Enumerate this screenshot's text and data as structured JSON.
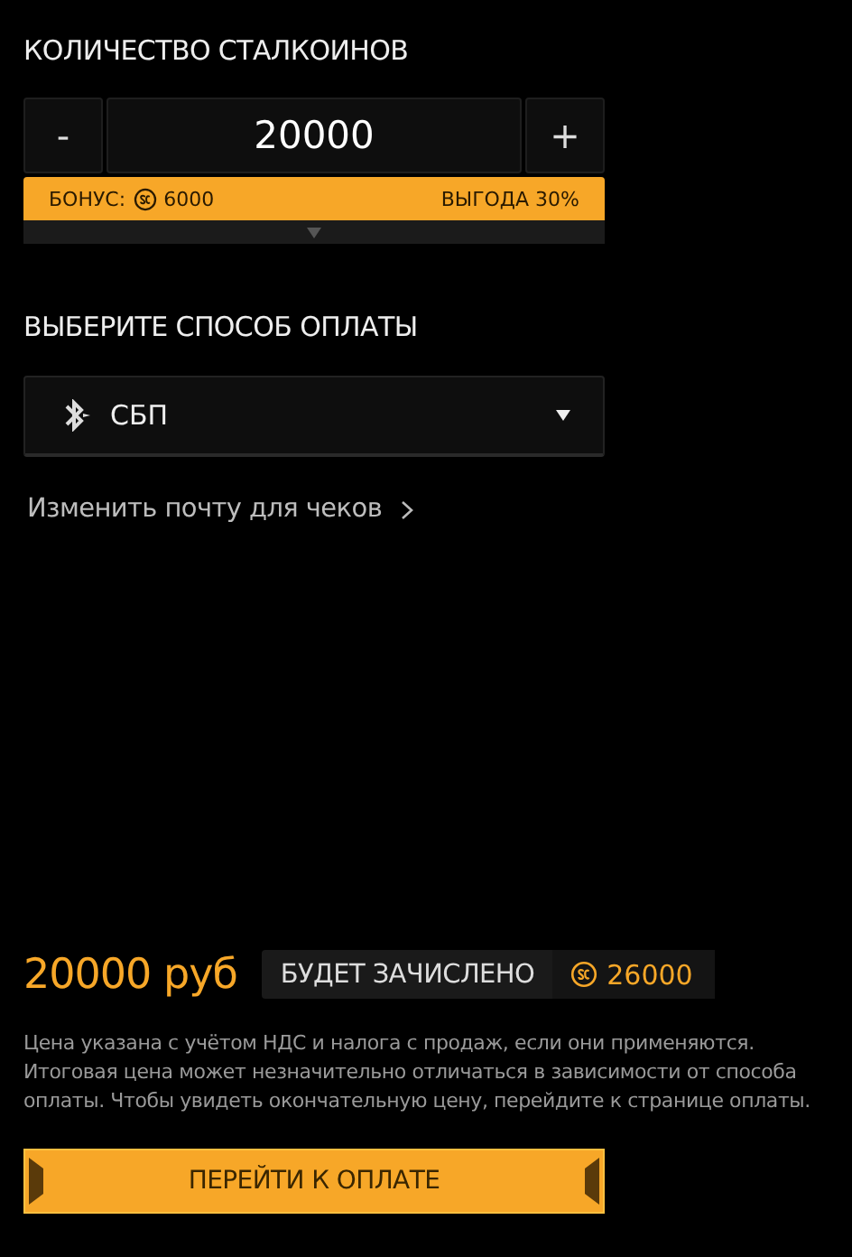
{
  "quantity_section": {
    "title": "КОЛИЧЕСТВО СТАЛКОИНОВ",
    "minus": "-",
    "value": "20000",
    "plus": "+",
    "bonus_label": "БОНУС:",
    "bonus_amount": "6000",
    "benefit": "ВЫГОДА 30%"
  },
  "payment_section": {
    "title": "ВЫБЕРИТЕ СПОСОБ ОПЛАТЫ",
    "method": "СБП"
  },
  "email_link": "Изменить почту для чеков",
  "summary": {
    "price": "20000 руб",
    "credited_label": "БУДЕТ ЗАЧИСЛЕНО",
    "credited_amount": "26000"
  },
  "disclaimer": "Цена указана с учётом НДС и налога с продаж, если они применяются. Итоговая цена может незначительно отличаться в зависимости от способа оплаты. Чтобы увидеть окончательную цену, перейдите к странице оплаты.",
  "pay_button": "ПЕРЕЙТИ К ОПЛАТЕ"
}
